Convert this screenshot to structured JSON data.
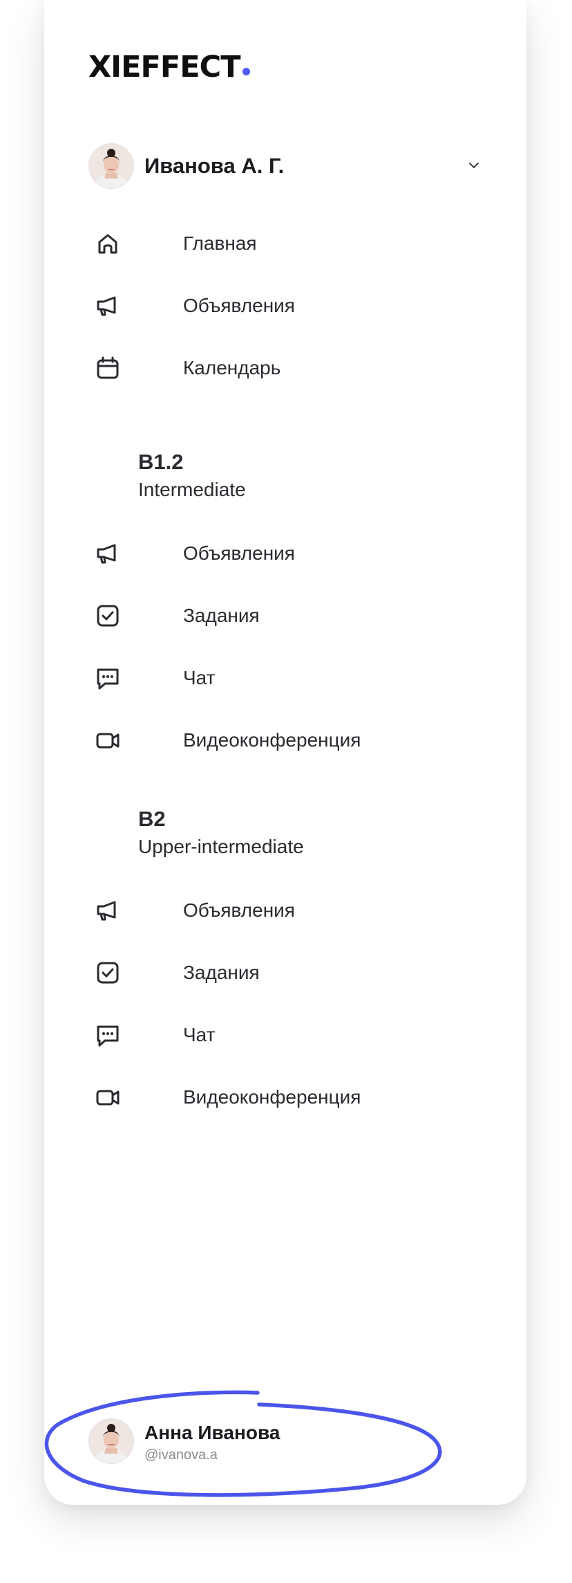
{
  "brand": {
    "name": "XIEFFECT",
    "accent": "#4e5af2"
  },
  "account_switcher": {
    "name": "Иванова А. Г."
  },
  "main_nav": [
    {
      "label": "Главная",
      "icon": "home-icon"
    },
    {
      "label": "Объявления",
      "icon": "megaphone-icon"
    },
    {
      "label": "Календарь",
      "icon": "calendar-icon"
    }
  ],
  "sections": [
    {
      "title": "B1.2",
      "subtitle": "Intermediate",
      "items": [
        {
          "label": "Объявления",
          "icon": "megaphone-icon"
        },
        {
          "label": "Задания",
          "icon": "task-check-icon"
        },
        {
          "label": "Чат",
          "icon": "chat-icon"
        },
        {
          "label": "Видеоконференция",
          "icon": "video-camera-icon"
        }
      ]
    },
    {
      "title": "B2",
      "subtitle": "Upper-intermediate",
      "items": [
        {
          "label": "Объявления",
          "icon": "megaphone-icon"
        },
        {
          "label": "Задания",
          "icon": "task-check-icon"
        },
        {
          "label": "Чат",
          "icon": "chat-icon"
        },
        {
          "label": "Видеоконференция",
          "icon": "video-camera-icon"
        }
      ]
    }
  ],
  "profile": {
    "name": "Анна Иванова",
    "handle": "@ivanova.a"
  },
  "highlight_color": "#4b55ea"
}
